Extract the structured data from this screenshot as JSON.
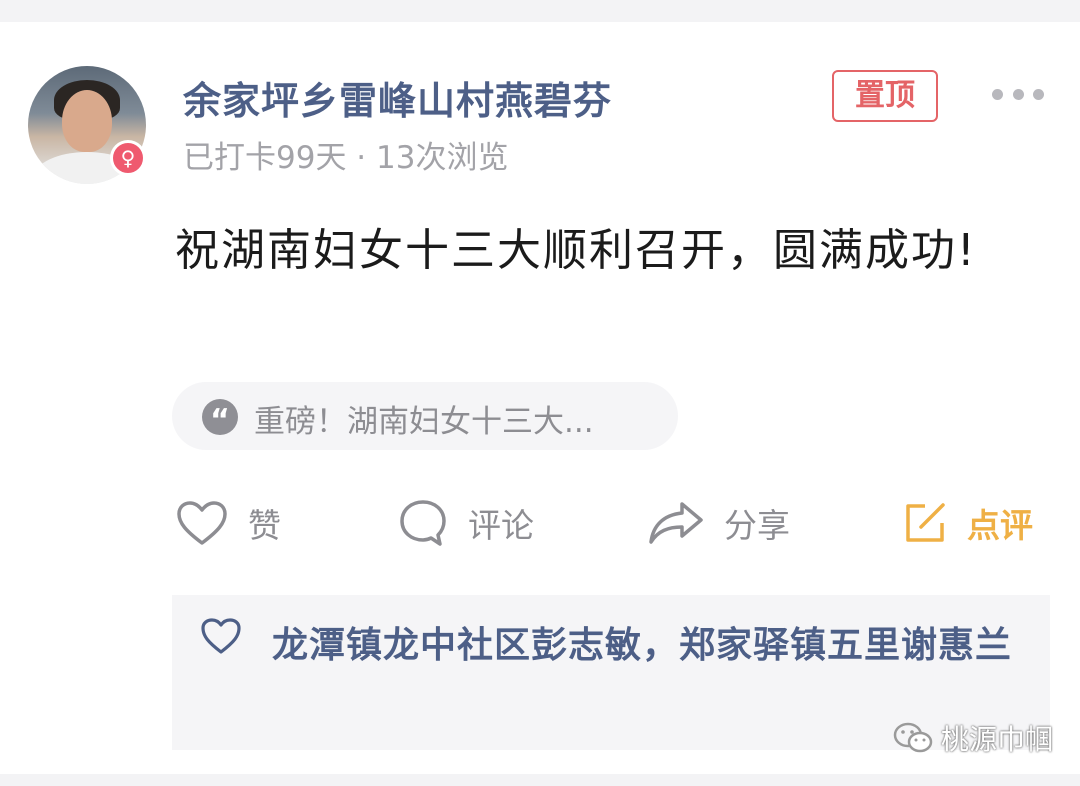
{
  "post": {
    "author": "余家坪乡雷峰山村燕碧芬",
    "meta": "已打卡99天 · 13次浏览",
    "pinned_label": "置顶",
    "content": "祝湖南妇女十三大顺利召开，圆满成功!",
    "quote_text": "重磅！湖南妇女十三大..."
  },
  "actions": {
    "like": "赞",
    "comment": "评论",
    "share": "分享",
    "review": "点评"
  },
  "likes": {
    "names": "龙潭镇龙中社区彭志敏，郑家驿镇五里谢惠兰"
  },
  "watermark": "桃源巾帼",
  "colors": {
    "author_blue": "#4d5f87",
    "pin_red": "#e46467",
    "review_orange": "#efb045",
    "gender_badge": "#ef5a6f"
  }
}
